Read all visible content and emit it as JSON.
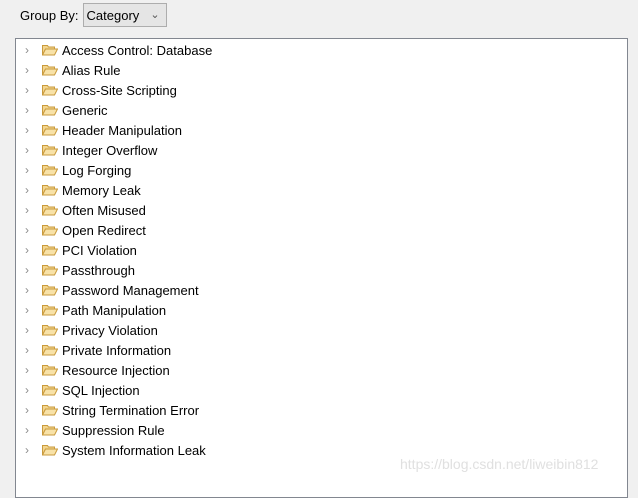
{
  "group_by": {
    "label": "Group By:",
    "value": "Category"
  },
  "categories": [
    "Access Control: Database",
    "Alias Rule",
    "Cross-Site Scripting",
    "Generic",
    "Header Manipulation",
    "Integer Overflow",
    "Log Forging",
    "Memory Leak",
    "Often Misused",
    "Open Redirect",
    "PCI Violation",
    "Passthrough",
    "Password Management",
    "Path Manipulation",
    "Privacy Violation",
    "Private Information",
    "Resource Injection",
    "SQL Injection",
    "String Termination Error",
    "Suppression Rule",
    "System Information Leak"
  ],
  "watermark": "https://blog.csdn.net/liweibin812",
  "colors": {
    "folder": "#dcb35c"
  }
}
